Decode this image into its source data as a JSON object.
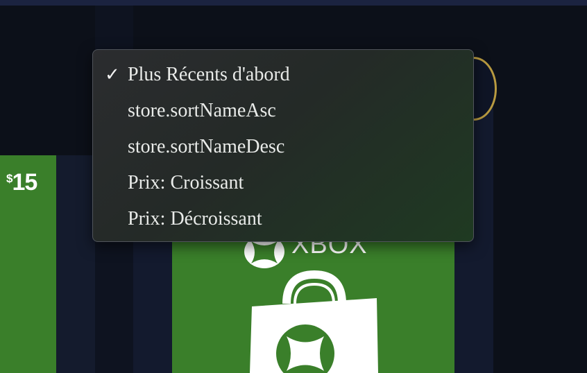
{
  "sort_menu": {
    "items": [
      {
        "label": "Plus Récents d'abord",
        "selected": true
      },
      {
        "label": "store.sortNameAsc",
        "selected": false
      },
      {
        "label": "store.sortNameDesc",
        "selected": false
      },
      {
        "label": "Prix: Croissant",
        "selected": false
      },
      {
        "label": "Prix: Décroissant",
        "selected": false
      }
    ],
    "check_mark": "✓"
  },
  "left_card": {
    "currency": "$",
    "amount": "15"
  },
  "xbox_tile": {
    "brand": "XBOX"
  },
  "colors": {
    "accent_green": "#3a7f2a",
    "ring_gold": "#b89a40",
    "background": "#0c1019"
  }
}
